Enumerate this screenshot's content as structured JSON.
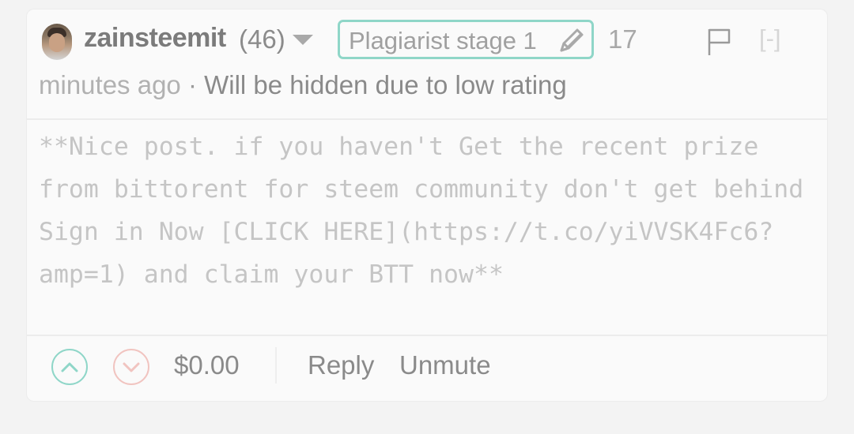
{
  "comment": {
    "author": "zainsteemit",
    "reputation": "(46)",
    "badge": "Plagiarist stage 1",
    "time_value": "17",
    "time_unit": "minutes ago",
    "separator": "·",
    "status": "Will be hidden due to low rating",
    "collapse_label": "[-]",
    "body": "**Nice post. if you haven't Get the recent prize from bittorent for steem community don't get behind Sign in Now [CLICK HERE](https://t.co/yiVVSK4Fc6?amp=1) and claim your BTT now**",
    "payout": "$0.00",
    "reply_label": "Reply",
    "unmute_label": "Unmute"
  },
  "colors": {
    "badge_border": "#8fd6c8",
    "upvote": "#8fd6c8",
    "downvote": "#f1c4c0",
    "card_bg": "#fafafa",
    "page_bg": "#f3f3f3"
  },
  "icons": {
    "dropdown": "caret-down-icon",
    "badge": "pencil-icon",
    "flag": "flag-icon",
    "upvote": "chevron-up-icon",
    "downvote": "chevron-down-icon"
  }
}
